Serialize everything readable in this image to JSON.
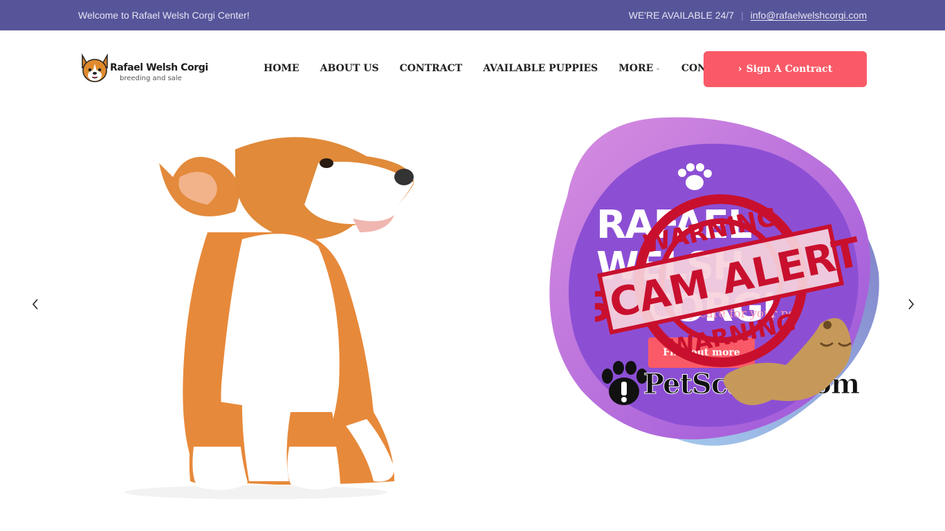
{
  "topbar": {
    "welcome": "Welcome to Rafael Welsh Corgi Center!",
    "availability": "WE'RE AVAILABLE 24/7",
    "separator": "|",
    "email": "info@rafaelwelshcorgi.com"
  },
  "logo": {
    "name": "Rafael Welsh Corgi",
    "tagline": "breeding and sale"
  },
  "nav": {
    "items": [
      {
        "label": "HOME"
      },
      {
        "label": "ABOUT US"
      },
      {
        "label": "CONTRACT"
      },
      {
        "label": "AVAILABLE PUPPIES"
      },
      {
        "label": "MORE"
      },
      {
        "label": "CONTACT"
      }
    ],
    "cta_label": "Sign A Contract",
    "cta_icon": "chevron-right-icon"
  },
  "hero": {
    "title_line1": "RAFAEL WELSH",
    "title_line2": "CORGI",
    "subtitle": "Trusted quality care for your pet",
    "button_label": "Find out more"
  },
  "stamp": {
    "top_text": "WARNING",
    "banner_text": "SCAM ALERT",
    "bottom_text": "WARNING"
  },
  "watermark": {
    "text": "PetScams.com"
  },
  "colors": {
    "topbar_bg": "#57559a",
    "accent": "#fa5a67",
    "stamp_red": "#c8102e",
    "blob_purple": "#8a4fd1"
  }
}
